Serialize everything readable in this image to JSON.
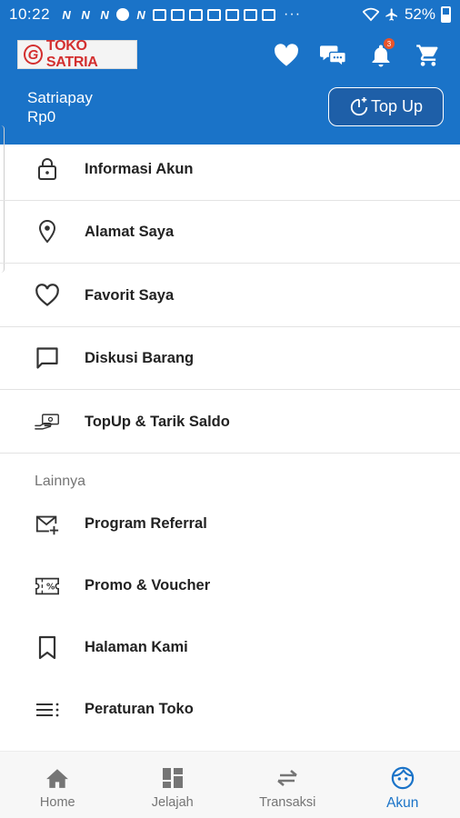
{
  "status_bar": {
    "time": "10:22",
    "notification_icons": [
      "n-icon",
      "n-icon",
      "n-icon",
      "opera-icon",
      "n-icon",
      "gallery-icon",
      "youtube-icon",
      "youtube-icon",
      "mail-icon",
      "mail-icon",
      "b-icon",
      "shop-icon",
      "mail-icon"
    ],
    "more": "···",
    "battery": "52%"
  },
  "header": {
    "logo_text": "TOKO SATRIA",
    "logo_mark": "G",
    "notification_count": "3",
    "wallet_label": "Satriapay",
    "wallet_balance": "Rp0",
    "topup_label": "Top Up",
    "brand_color": "#1a73c8"
  },
  "menu": {
    "items": [
      {
        "label": "Informasi Akun",
        "icon": "lock-icon"
      },
      {
        "label": "Alamat Saya",
        "icon": "location-pin-icon"
      },
      {
        "label": "Favorit Saya",
        "icon": "heart-outline-icon"
      },
      {
        "label": "Diskusi Barang",
        "icon": "chat-bubble-icon"
      },
      {
        "label": "TopUp & Tarik Saldo",
        "icon": "hand-money-icon"
      }
    ],
    "section_title": "Lainnya",
    "other_items": [
      {
        "label": "Program Referral",
        "icon": "mail-plus-icon"
      },
      {
        "label": "Promo & Voucher",
        "icon": "voucher-icon"
      },
      {
        "label": "Halaman Kami",
        "icon": "bookmark-icon"
      },
      {
        "label": "Peraturan Toko",
        "icon": "list-icon"
      }
    ]
  },
  "bottom_nav": {
    "items": [
      {
        "label": "Home",
        "icon": "home-icon"
      },
      {
        "label": "Jelajah",
        "icon": "dashboard-icon"
      },
      {
        "label": "Transaksi",
        "icon": "swap-arrows-icon"
      },
      {
        "label": "Akun",
        "icon": "face-icon",
        "active": true
      }
    ],
    "active_color": "#1a73c8"
  }
}
